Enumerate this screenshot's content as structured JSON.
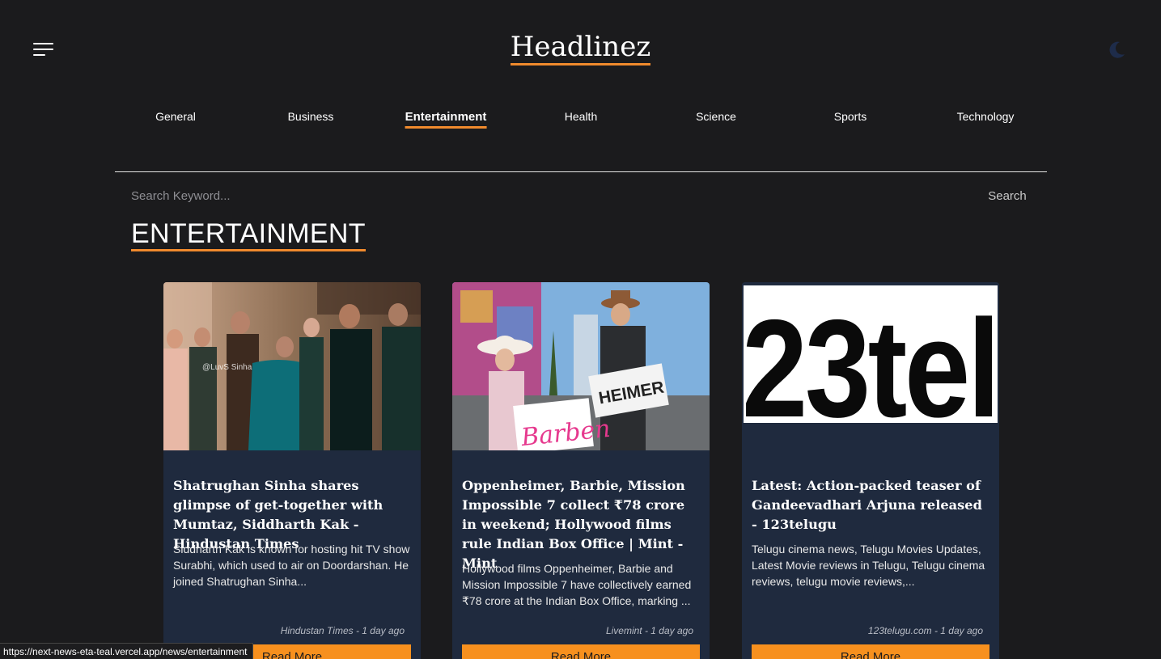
{
  "header": {
    "logo": "Headlinez",
    "menu_icon": "hamburger-menu-icon",
    "theme_icon": "moon-icon"
  },
  "nav": {
    "items": [
      {
        "label": "General"
      },
      {
        "label": "Business"
      },
      {
        "label": "Entertainment",
        "active": true
      },
      {
        "label": "Health"
      },
      {
        "label": "Science"
      },
      {
        "label": "Sports"
      },
      {
        "label": "Technology"
      }
    ]
  },
  "search": {
    "placeholder": "Search Keyword...",
    "button_label": "Search"
  },
  "section": {
    "title": "ENTERTAINMENT"
  },
  "cards": [
    {
      "title": "Shatrughan Sinha shares glimpse of get-together with Mumtaz, Siddharth Kak - Hindustan Times",
      "description": "Siddharth Kak is known for hosting hit TV show Surabhi, which used to air on Doordarshan. He joined Shatrughan Sinha...",
      "source_time": "Hindustan Times - 1 day ago",
      "button_label": "Read More",
      "image_watermark": "@LuvS Sinha"
    },
    {
      "title": "Oppenheimer, Barbie, Mission Impossible 7 collect ₹78 crore in weekend; Hollywood films rule Indian Box Office | Mint - Mint",
      "description": "Hollywood films Oppenheimer, Barbie and Mission Impossible 7 have collectively earned ₹78 crore at the Indian Box Office, marking ...",
      "source_time": "Livemint - 1 day ago",
      "button_label": "Read More",
      "image_sign_left": "Barben",
      "image_sign_right": "HEIMER"
    },
    {
      "title": "Latest: Action-packed teaser of Gandeevadhari Arjuna released - 123telugu",
      "description": "Telugu cinema news, Telugu Movies Updates, Latest Movie reviews in Telugu, Telugu cinema reviews, telugu movie reviews,...",
      "source_time": "123telugu.com - 1 day ago",
      "button_label": "Read More",
      "image_logo_text": "23tel"
    }
  ],
  "status_bar": {
    "url": "https://next-news-eta-teal.vercel.app/news/entertainment"
  },
  "colors": {
    "background": "#1b1b1d",
    "card": "#1f2a3e",
    "accent": "#f08a2d",
    "button": "#f7901e"
  }
}
